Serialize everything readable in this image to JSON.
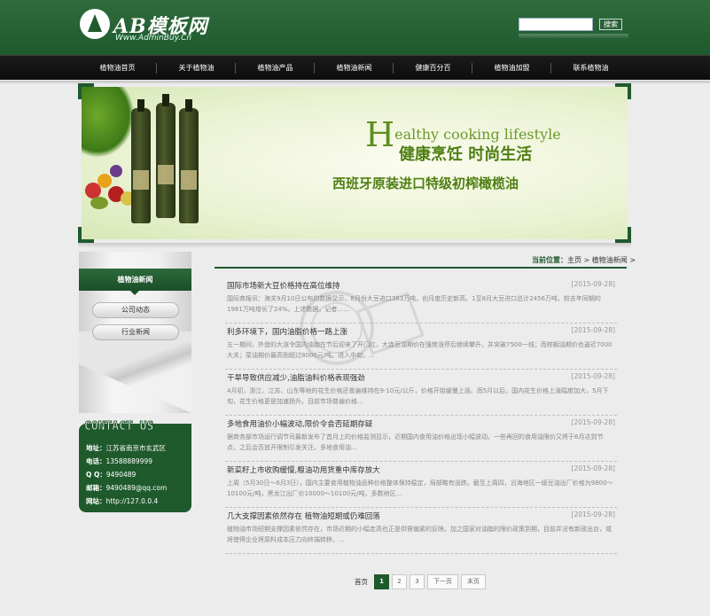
{
  "header": {
    "logo_main": "AB模板网",
    "logo_sub": "Www.AdminBuy.Cn",
    "search_placeholder": "",
    "search_button": "搜索"
  },
  "nav": [
    {
      "label": "植物油首页"
    },
    {
      "label": "关于植物油"
    },
    {
      "label": "植物油产品"
    },
    {
      "label": "植物油新闻"
    },
    {
      "label": "健康百分百"
    },
    {
      "label": "植物油加盟"
    },
    {
      "label": "联系植物油"
    }
  ],
  "banner": {
    "title_initial": "H",
    "title_rest": "ealthy cooking lifestyle",
    "slogan": "健康烹饪 时尚生活",
    "subtitle": "西班牙原装进口特级初榨橄榄油"
  },
  "sidebar": {
    "heading": "植物油新闻",
    "buttons": [
      {
        "label": "公司动态"
      },
      {
        "label": "行业新闻"
      }
    ]
  },
  "contact": {
    "title": "CONTACT US",
    "rows": [
      {
        "label": "地址：",
        "value": "江苏省南京市玄武区"
      },
      {
        "label": "电话：",
        "value": "13588889999"
      },
      {
        "label": "Q Q：",
        "value": "9490489"
      },
      {
        "label": "邮箱：",
        "value": "9490489@qq.com"
      },
      {
        "label": "网站：",
        "value": "http://127.0.0.4"
      }
    ]
  },
  "breadcrumb": {
    "prefix": "当前位置：",
    "home": "主页",
    "sep": " > ",
    "current": "植物油新闻",
    "tail": " >"
  },
  "news": [
    {
      "title": "国际市场新大豆价格持在高位维持",
      "date": "[2015-09-28]",
      "desc": "国际商报讯：海关9月10日公布的数据显示，8月份大豆进口383万吨，创月度历史新高。1至8月大豆进口总计2456万吨，较去年同期的1981万吨增长了24%。上述数据，记者……"
    },
    {
      "title": "利多环境下，国内油脂价格一路上涨",
      "date": "[2015-09-28]",
      "desc": "五一期间，外盘的大涨令国内油脂在节后迎来了开门红，大连豆油期价在强势涨停后继续攀升，并突破7500一线；而棕榈油期价也逼近7000大关；菜油期价最高则超过8000元/吨。进入中旬，..."
    },
    {
      "title": "干旱导致供应减少,油脂油料价格表现强劲",
      "date": "[2015-09-28]",
      "desc": "4月初，浙江、江苏、山东等地的花生价格还普遍维持在9-10元/公斤，价格开始缓慢上涨。而5月以后，国内花生价格上涨幅度加大，5月下旬，花生价格更是加速扬升。目前市场普遍价格..."
    },
    {
      "title": "多地食用油价小幅波动,限价令会否延期存疑",
      "date": "[2015-09-28]",
      "desc": "据商务部市场运行调节司最新发布了首月上的价格监测显示，近期国内食用油价格出现小幅波动。一些再回的食用油限价又将于6月达到节点，之后会否放开限制引发关注。多地食用油..."
    },
    {
      "title": "新菜籽上市收购缓慢,粮油功用货重中库存放大",
      "date": "[2015-09-28]",
      "desc": "上周（5月30日～6月3日），国内主要食用植物油品种价格整体保持稳定，局部略有涨跌。截至上周四，沿海地区一级豆油出厂价格为9800～10100元/吨，黑龙江出厂价10000～10100元/吨，多数地区..."
    },
    {
      "title": "几大支撑因素依然存在 植物油短期或仍难回落",
      "date": "[2015-09-28]",
      "desc": "植物油市场短期支撑因素依然存在，市场近期的小幅走高也正是供需偏紧的反映。加之国家对油脂的限价政策到期，目前并没有新政出台，或将使得企业将原料成本压力向终端转移。..."
    }
  ],
  "pager": {
    "label": "首页",
    "pages": [
      "1",
      "2",
      "3"
    ],
    "next": "下一页",
    "last": "末页"
  }
}
